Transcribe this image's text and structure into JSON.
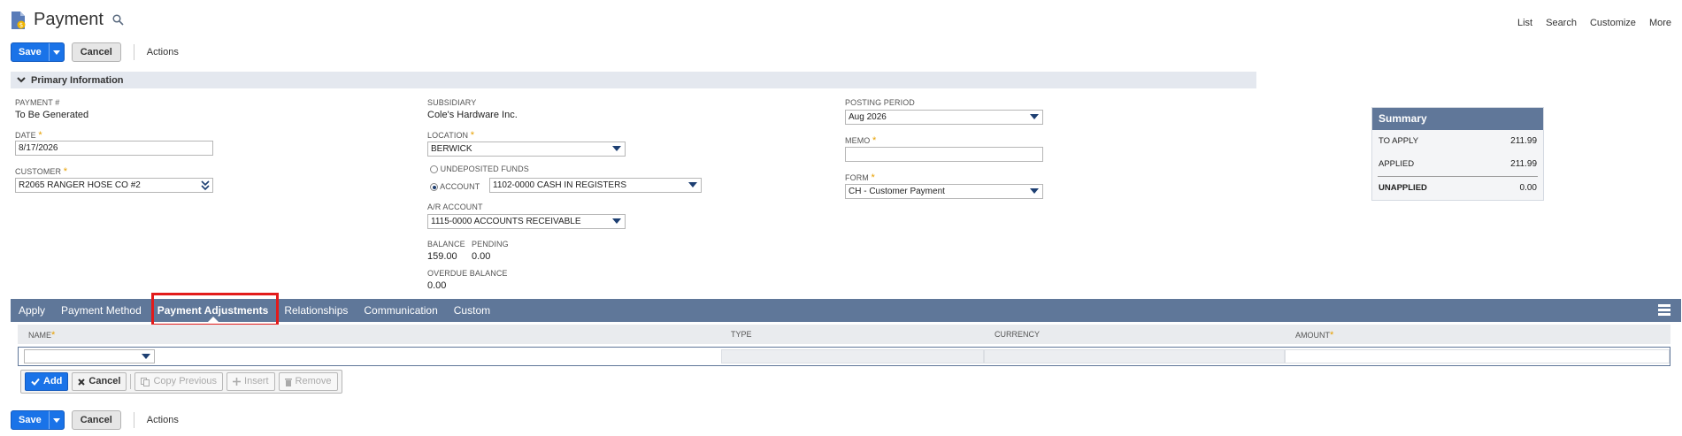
{
  "header": {
    "title": "Payment"
  },
  "top_links": [
    "List",
    "Search",
    "Customize",
    "More"
  ],
  "toolbar": {
    "save_label": "Save",
    "cancel_label": "Cancel",
    "actions_label": "Actions"
  },
  "section": {
    "title": "Primary Information"
  },
  "fields": {
    "payment_num": {
      "label": "PAYMENT #",
      "value": "To Be Generated"
    },
    "date": {
      "label": "DATE",
      "value": "8/17/2026"
    },
    "customer": {
      "label": "CUSTOMER",
      "value": "R2065 RANGER HOSE CO #2"
    },
    "subsidiary": {
      "label": "SUBSIDIARY",
      "value": "Cole's Hardware Inc."
    },
    "location": {
      "label": "LOCATION",
      "value": "BERWICK"
    },
    "undeposited": {
      "label": "UNDEPOSITED FUNDS"
    },
    "account": {
      "label": "ACCOUNT",
      "value": "1102-0000 CASH IN REGISTERS"
    },
    "ar_account": {
      "label": "A/R ACCOUNT",
      "value": "1115-0000 ACCOUNTS RECEIVABLE"
    },
    "balance": {
      "label": "BALANCE",
      "value": "159.00"
    },
    "pending": {
      "label": "PENDING",
      "value": "0.00"
    },
    "overdue": {
      "label": "OVERDUE BALANCE",
      "value": "0.00"
    },
    "posting_period": {
      "label": "POSTING PERIOD",
      "value": "Aug 2026"
    },
    "memo": {
      "label": "MEMO",
      "value": ""
    },
    "form": {
      "label": "FORM",
      "value": "CH - Customer Payment"
    }
  },
  "summary": {
    "title": "Summary",
    "to_apply": {
      "label": "TO APPLY",
      "value": "211.99"
    },
    "applied": {
      "label": "APPLIED",
      "value": "211.99"
    },
    "unapplied": {
      "label": "UNAPPLIED",
      "value": "0.00"
    }
  },
  "tabs": [
    {
      "label": "Apply"
    },
    {
      "label": "Payment Method"
    },
    {
      "label": "Payment Adjustments"
    },
    {
      "label": "Relationships"
    },
    {
      "label": "Communication"
    },
    {
      "label": "Custom"
    }
  ],
  "grid": {
    "col_name": "NAME",
    "col_type": "TYPE",
    "col_currency": "CURRENCY",
    "col_amount": "AMOUNT"
  },
  "line_buttons": {
    "add": "Add",
    "cancel": "Cancel",
    "copy_previous": "Copy Previous",
    "insert": "Insert",
    "remove": "Remove"
  },
  "colors": {
    "primary_button": "#1a73e8",
    "tab_bar": "#5f7799",
    "required": "#e7a000",
    "highlight": "#e21b1b"
  }
}
